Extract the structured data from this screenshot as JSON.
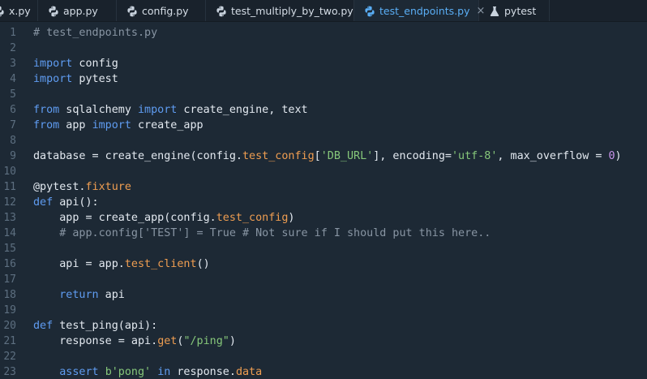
{
  "tabs": [
    {
      "label": "x.py",
      "icon": "python-icon",
      "active": false
    },
    {
      "label": "app.py",
      "icon": "python-icon",
      "active": false
    },
    {
      "label": "config.py",
      "icon": "python-icon",
      "active": false
    },
    {
      "label": "test_multiply_by_two.py",
      "icon": "python-icon",
      "active": false
    },
    {
      "label": "test_endpoints.py",
      "icon": "python-icon",
      "active": true,
      "close": "×"
    },
    {
      "label": "pytest",
      "icon": "flask-icon",
      "active": false
    }
  ],
  "colors": {
    "background": "#1d2935",
    "keyword": "#5f9cf1",
    "string": "#86c77a",
    "comment": "#8895a3",
    "attribute": "#ee9d51",
    "number": "#c792ea",
    "active_tab": "#5aaef5"
  },
  "editor": {
    "lines": [
      {
        "n": "1",
        "tokens": [
          [
            "cm",
            "# test_endpoints.py"
          ]
        ]
      },
      {
        "n": "2",
        "tokens": []
      },
      {
        "n": "3",
        "tokens": [
          [
            "kw",
            "import"
          ],
          [
            "pl",
            " config"
          ]
        ]
      },
      {
        "n": "4",
        "tokens": [
          [
            "kw",
            "import"
          ],
          [
            "pl",
            " pytest"
          ]
        ]
      },
      {
        "n": "5",
        "tokens": []
      },
      {
        "n": "6",
        "tokens": [
          [
            "kw",
            "from"
          ],
          [
            "pl",
            " sqlalchemy "
          ],
          [
            "kw",
            "import"
          ],
          [
            "pl",
            " create_engine, text"
          ]
        ]
      },
      {
        "n": "7",
        "tokens": [
          [
            "kw",
            "from"
          ],
          [
            "pl",
            " app "
          ],
          [
            "kw",
            "import"
          ],
          [
            "pl",
            " create_app"
          ]
        ]
      },
      {
        "n": "8",
        "tokens": []
      },
      {
        "n": "9",
        "tokens": [
          [
            "pl",
            "database = create_engine(config."
          ],
          [
            "attr",
            "test_config"
          ],
          [
            "pl",
            "["
          ],
          [
            "str",
            "'DB_URL'"
          ],
          [
            "pl",
            "], encoding="
          ],
          [
            "str",
            "'utf-8'"
          ],
          [
            "pl",
            ", max_overflow = "
          ],
          [
            "num",
            "0"
          ],
          [
            "pl",
            ")"
          ]
        ]
      },
      {
        "n": "10",
        "tokens": []
      },
      {
        "n": "11",
        "tokens": [
          [
            "pl",
            "@pytest."
          ],
          [
            "attr",
            "fixture"
          ]
        ]
      },
      {
        "n": "12",
        "tokens": [
          [
            "kw",
            "def"
          ],
          [
            "pl",
            " api():"
          ]
        ]
      },
      {
        "n": "13",
        "tokens": [
          [
            "pl",
            "    app = create_app(config."
          ],
          [
            "attr",
            "test_config"
          ],
          [
            "pl",
            ")"
          ]
        ]
      },
      {
        "n": "14",
        "tokens": [
          [
            "cm",
            "    # app.config['TEST'] = True # Not sure if I should put this here.."
          ]
        ]
      },
      {
        "n": "15",
        "tokens": []
      },
      {
        "n": "16",
        "tokens": [
          [
            "pl",
            "    api = app."
          ],
          [
            "attr",
            "test_client"
          ],
          [
            "pl",
            "()"
          ]
        ]
      },
      {
        "n": "17",
        "tokens": []
      },
      {
        "n": "18",
        "tokens": [
          [
            "kw",
            "    return"
          ],
          [
            "pl",
            " api"
          ]
        ]
      },
      {
        "n": "19",
        "tokens": []
      },
      {
        "n": "20",
        "tokens": [
          [
            "kw",
            "def"
          ],
          [
            "pl",
            " test_ping(api):"
          ]
        ]
      },
      {
        "n": "21",
        "tokens": [
          [
            "pl",
            "    response = api."
          ],
          [
            "attr",
            "get"
          ],
          [
            "pl",
            "("
          ],
          [
            "str",
            "\"/ping\""
          ],
          [
            "pl",
            ")"
          ]
        ]
      },
      {
        "n": "22",
        "tokens": []
      },
      {
        "n": "23",
        "tokens": [
          [
            "kw",
            "    assert"
          ],
          [
            "pl",
            " "
          ],
          [
            "str",
            "b'pong'"
          ],
          [
            "pl",
            " "
          ],
          [
            "kw",
            "in"
          ],
          [
            "pl",
            " response."
          ],
          [
            "attr",
            "data"
          ]
        ]
      }
    ]
  }
}
